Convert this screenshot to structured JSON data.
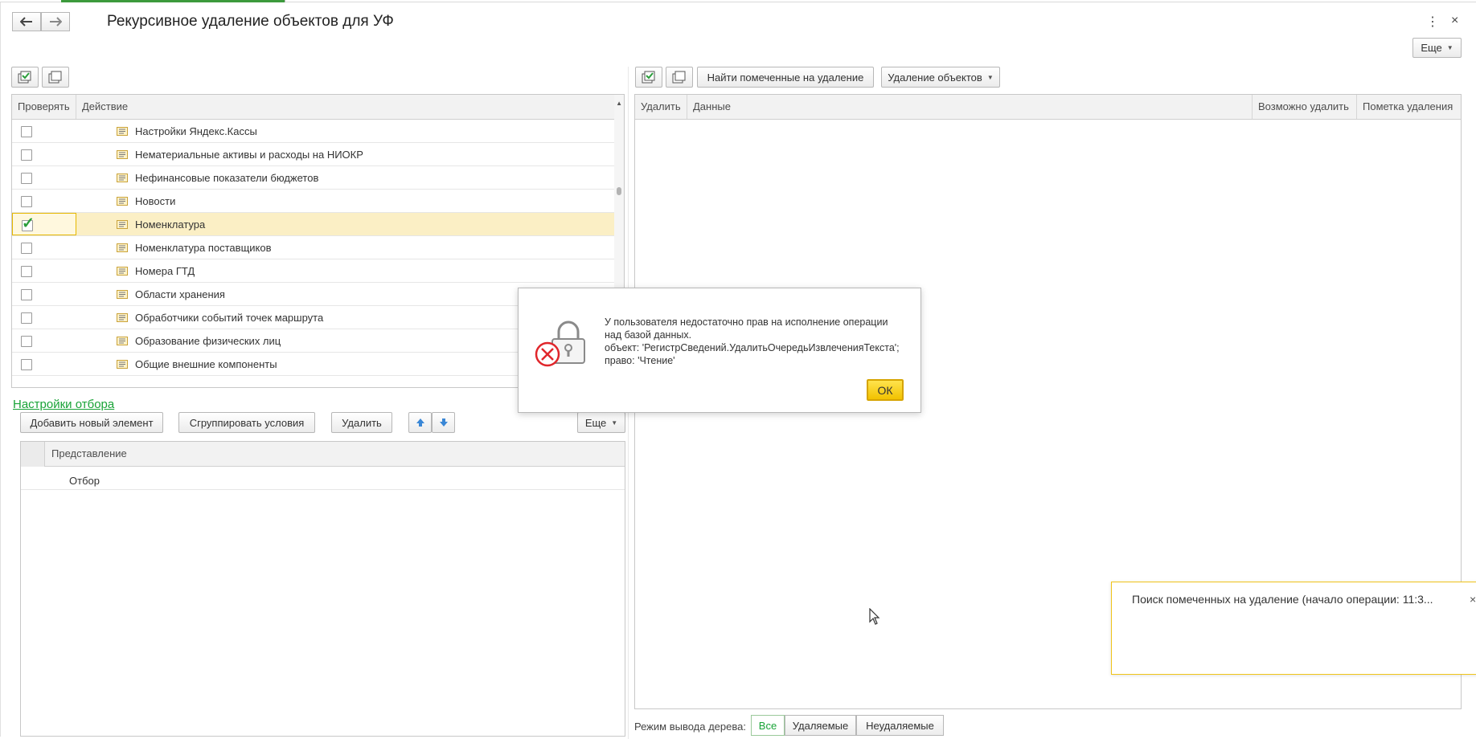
{
  "window": {
    "title": "Рекурсивное удаление объектов для УФ",
    "more_label": "Еще",
    "menu_glyph": "⋮",
    "close_glyph": "×"
  },
  "left_tree": {
    "columns": [
      "Проверять",
      "Действие"
    ],
    "rows": [
      {
        "label": "Настройки Яндекс.Кассы",
        "checked": false
      },
      {
        "label": "Нематериальные активы и расходы на НИОКР",
        "checked": false
      },
      {
        "label": "Нефинансовые показатели бюджетов",
        "checked": false
      },
      {
        "label": "Новости",
        "checked": false
      },
      {
        "label": "Номенклатура",
        "checked": true
      },
      {
        "label": "Номенклатура поставщиков",
        "checked": false
      },
      {
        "label": "Номера ГТД",
        "checked": false
      },
      {
        "label": "Области хранения",
        "checked": false
      },
      {
        "label": "Обработчики событий точек маршрута",
        "checked": false
      },
      {
        "label": "Образование физических лиц",
        "checked": false
      },
      {
        "label": "Общие внешние компоненты",
        "checked": false
      }
    ]
  },
  "filter": {
    "link": "Настройки отбора",
    "add_label": "Добавить новый элемент",
    "group_label": "Сгруппировать условия",
    "delete_label": "Удалить",
    "more_label": "Еще",
    "column": "Представление",
    "row": "Отбор"
  },
  "right_panel": {
    "find_label": "Найти помеченные на удаление",
    "delete_objects_label": "Удаление объектов",
    "columns": [
      "Удалить",
      "Данные",
      "Возможно удалить",
      "Пометка удаления"
    ],
    "mode_label": "Режим вывода дерева:",
    "modes": [
      "Все",
      "Удаляемые",
      "Неудаляемые"
    ]
  },
  "dialog": {
    "line1": "У пользователя недостаточно прав на исполнение операции",
    "line2": "над базой данных.",
    "line3": "объект: 'РегистрСведений.УдалитьОчередьИзвлеченияТекста';",
    "line4": "право: 'Чтение'",
    "ok_label": "ОК"
  },
  "toast": {
    "text": "Поиск помеченных на удаление (начало операции: 11:3...",
    "close_glyph": "×"
  },
  "colors": {
    "accent_green": "#19a337",
    "selected_row": "#fbefc5",
    "ok_yellow": "#f2c200",
    "error_red": "#e0262b"
  }
}
